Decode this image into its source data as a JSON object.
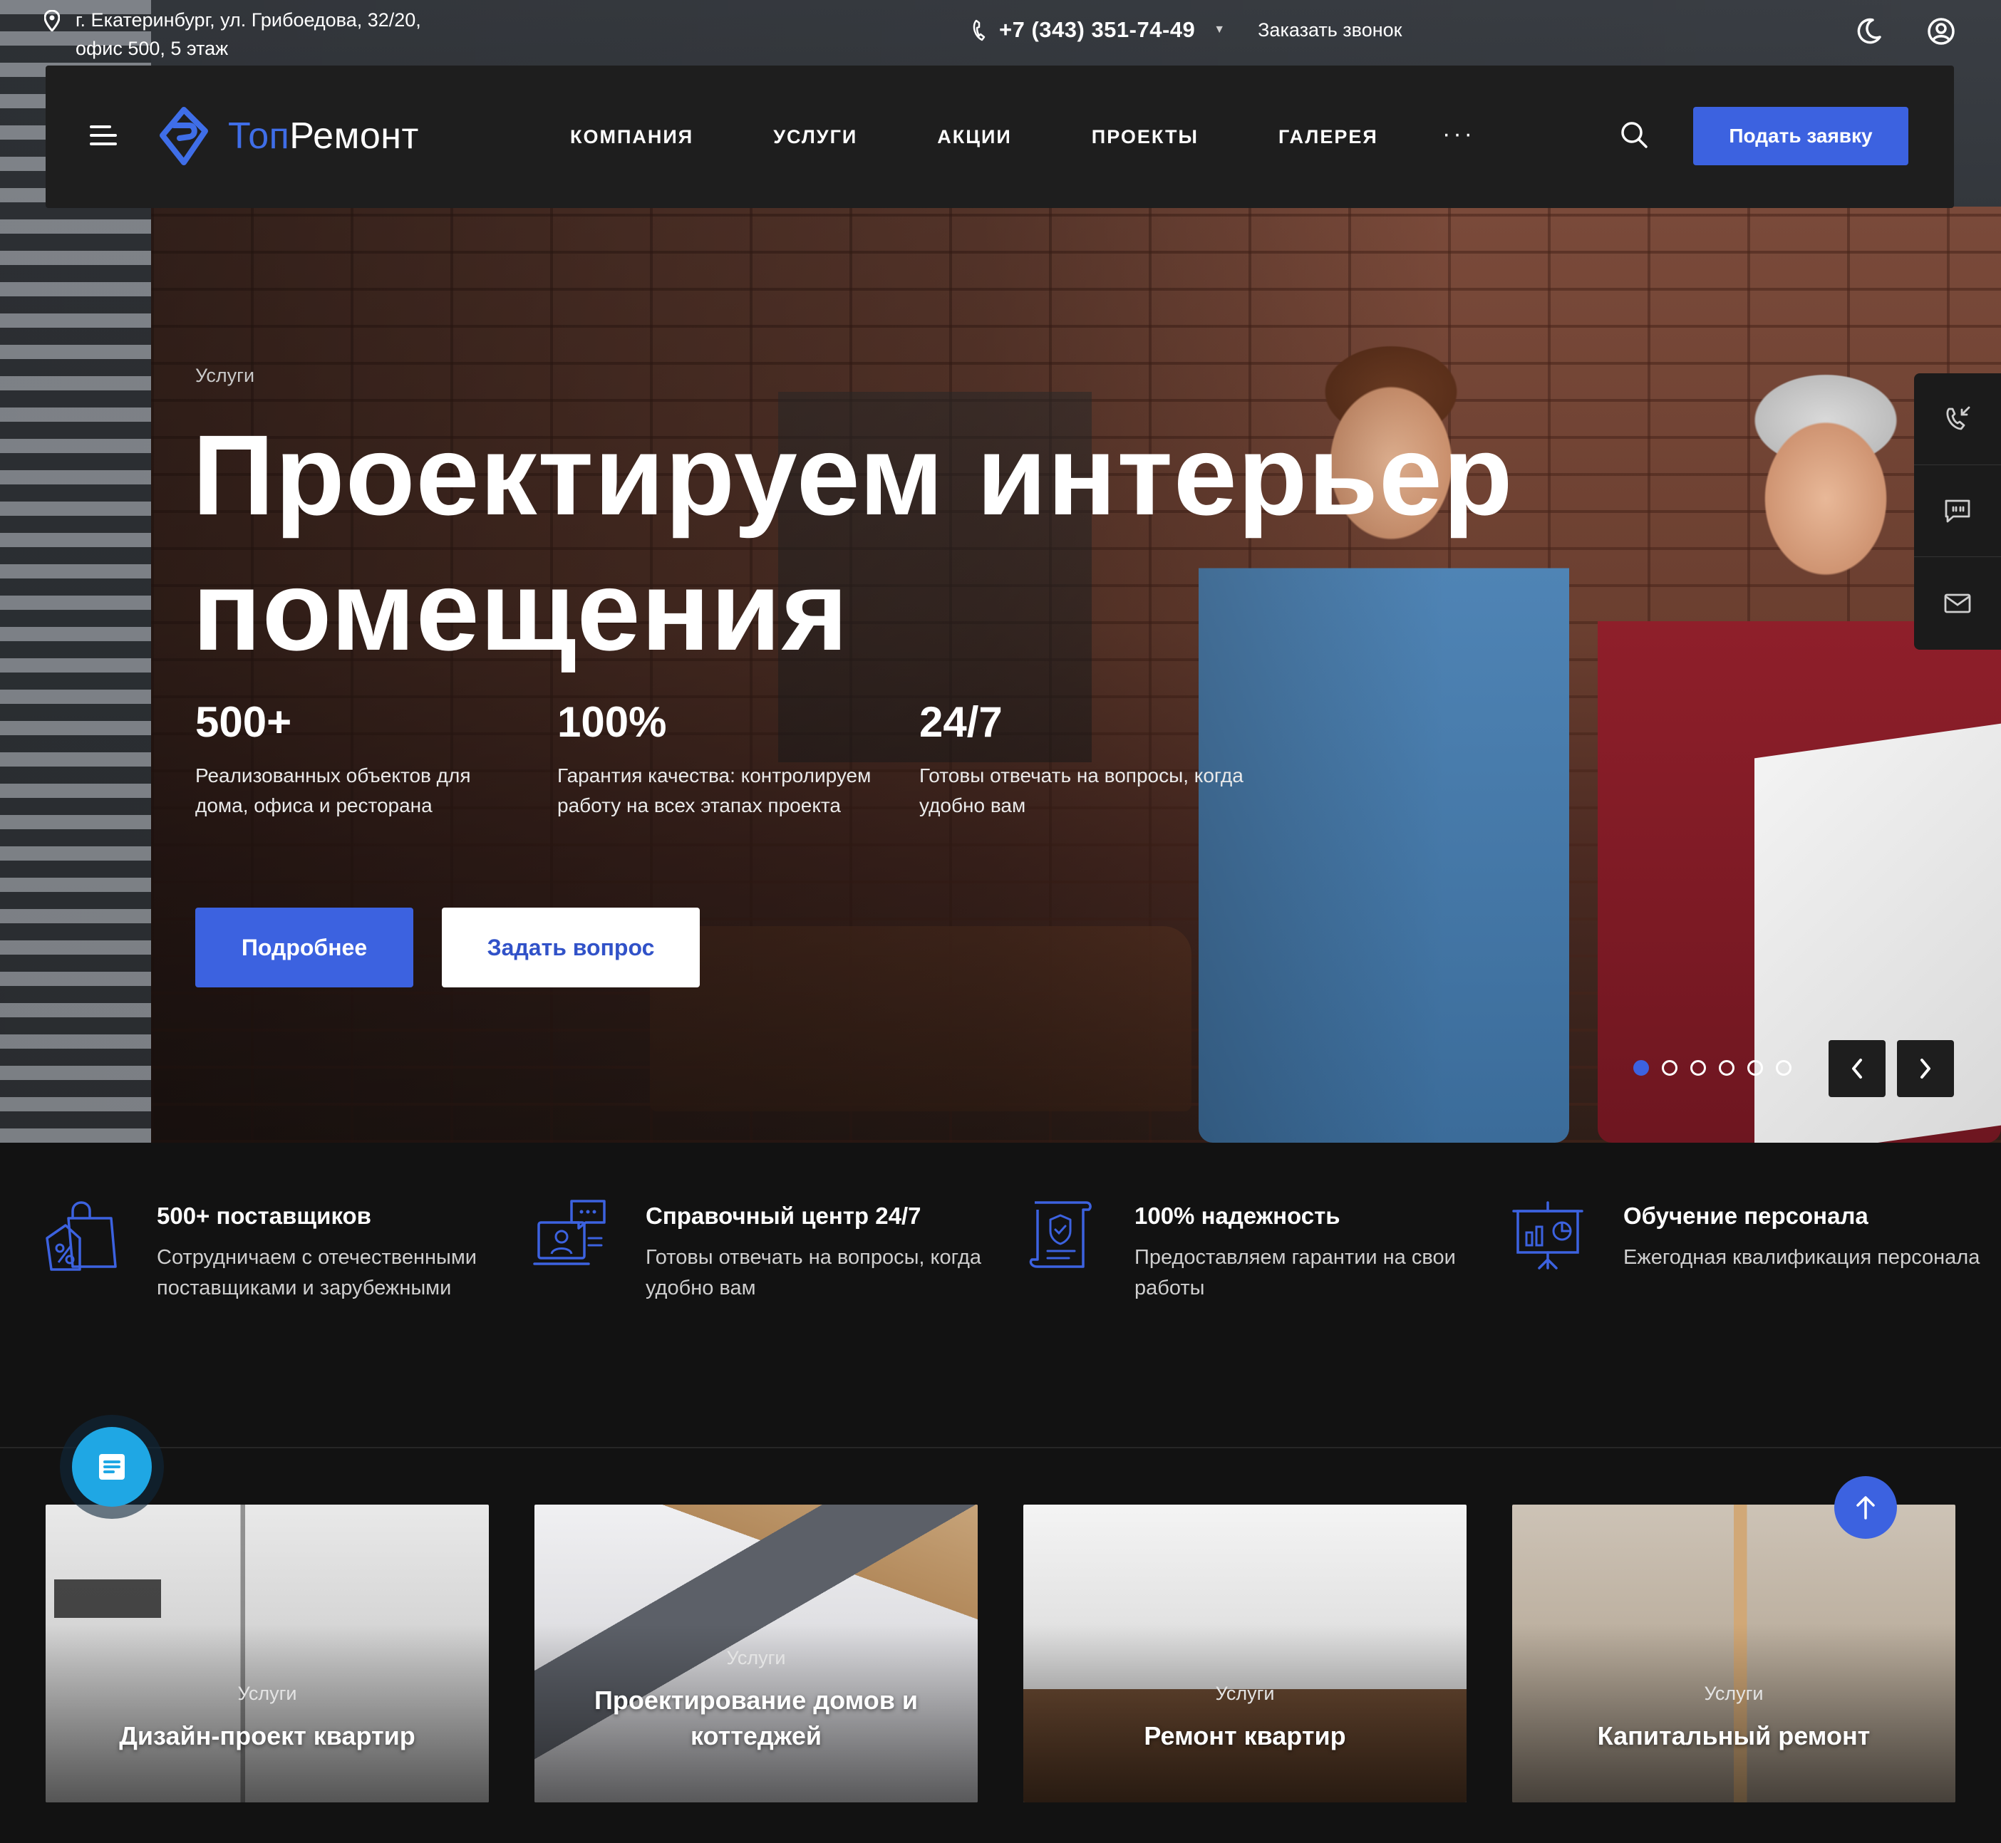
{
  "topbar": {
    "address_line1": "г. Екатеринбург, ул. Грибоедова, 32/20,",
    "address_line2": "офис 500, 5 этаж",
    "phone": "+7 (343) 351-74-49",
    "callback": "Заказать звонок",
    "icons": [
      "map-pin-icon",
      "phone-icon",
      "moon-icon",
      "user-icon"
    ]
  },
  "header": {
    "logo_prefix": "Топ",
    "logo_suffix": "Ремонт",
    "nav": [
      "КОМПАНИЯ",
      "УСЛУГИ",
      "АКЦИИ",
      "ПРОЕКТЫ",
      "ГАЛЕРЕЯ"
    ],
    "more": "···",
    "request_button": "Подать заявку"
  },
  "hero": {
    "kicker": "Услуги",
    "title": "Проектируем интерьер помещения",
    "stats": [
      {
        "value": "500+",
        "text": "Реализованных объектов для дома, офиса и ресторана"
      },
      {
        "value": "100%",
        "text": "Гарантия качества: контролируем работу на всех этапах проекта"
      },
      {
        "value": "24/7",
        "text": "Готовы отвечать на вопросы, когда удобно вам"
      }
    ],
    "primary_button": "Подробнее",
    "secondary_button": "Задать вопрос",
    "slides_total": 6,
    "active_slide": 1
  },
  "features": [
    {
      "title": "500+ поставщиков",
      "text": "Сотрудничаем с отечественными поставщиками и зарубежными",
      "icon": "shopping-bag-discount-icon"
    },
    {
      "title": "Справочный центр 24/7",
      "text": "Готовы отвечать на вопросы, когда удобно вам",
      "icon": "support-center-icon"
    },
    {
      "title": "100% надежность",
      "text": "Предоставляем гарантии на свои работы",
      "icon": "shield-document-icon"
    },
    {
      "title": "Обучение персонала",
      "text": "Ежегодная квалификация персонала",
      "icon": "presentation-board-icon"
    }
  ],
  "cards": [
    {
      "kicker": "Услуги",
      "title": "Дизайн-проект квартир"
    },
    {
      "kicker": "Услуги",
      "title": "Проектирование домов и коттеджей"
    },
    {
      "kicker": "Услуги",
      "title": "Ремонт квартир"
    },
    {
      "kicker": "Услуги",
      "title": "Капитальный ремонт"
    }
  ],
  "colors": {
    "accent": "#3c62e0",
    "background": "#121212",
    "header": "#1e1e1e",
    "fab": "#1fa7e4"
  }
}
